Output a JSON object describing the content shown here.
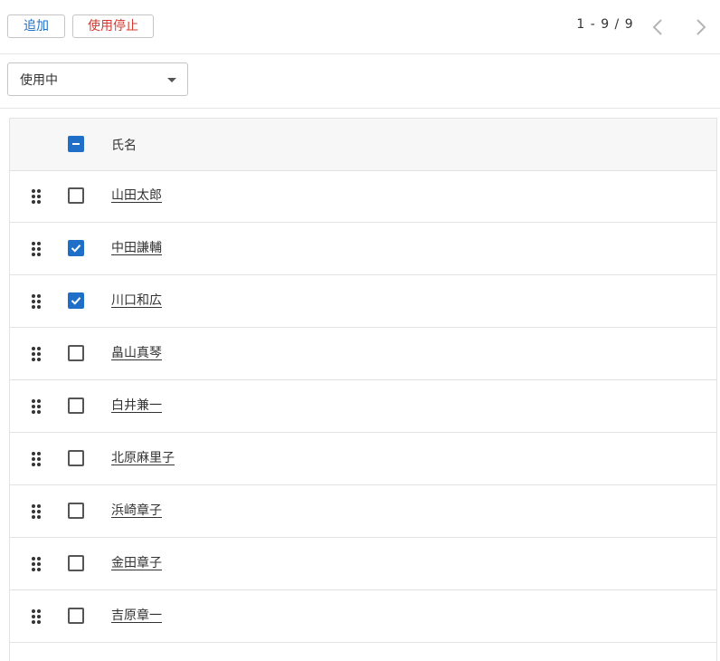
{
  "toolbar": {
    "add_label": "追加",
    "stop_label": "使用停止"
  },
  "pager": {
    "text": "1 - 9 / 9"
  },
  "filter": {
    "selected": "使用中"
  },
  "table": {
    "header_name": "氏名",
    "header_checkbox_state": "indeterminate",
    "rows": [
      {
        "name": "山田太郎",
        "checked": false
      },
      {
        "name": "中田謙輔",
        "checked": true
      },
      {
        "name": "川口和広",
        "checked": true
      },
      {
        "name": "畠山真琴",
        "checked": false
      },
      {
        "name": "白井兼一",
        "checked": false
      },
      {
        "name": "北原麻里子",
        "checked": false
      },
      {
        "name": "浜崎章子",
        "checked": false
      },
      {
        "name": "金田章子",
        "checked": false
      },
      {
        "name": "吉原章一",
        "checked": false
      }
    ]
  },
  "colors": {
    "accent": "#1f6fc9",
    "danger": "#d2382f"
  },
  "icons": {
    "drag": "drag-handle-icon",
    "prev": "chevron-left-icon",
    "next": "chevron-right-icon",
    "caret": "caret-down-icon"
  }
}
